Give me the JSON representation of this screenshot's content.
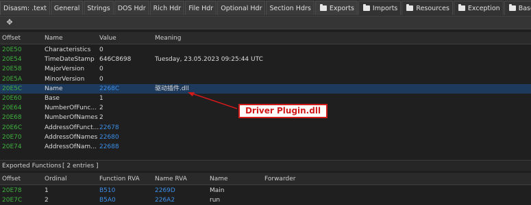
{
  "tabs": [
    {
      "label": "Disasm: .text",
      "folder": false
    },
    {
      "label": "General",
      "folder": false
    },
    {
      "label": "Strings",
      "folder": false
    },
    {
      "label": "DOS Hdr",
      "folder": false
    },
    {
      "label": "Rich Hdr",
      "folder": false
    },
    {
      "label": "File Hdr",
      "folder": false
    },
    {
      "label": "Optional Hdr",
      "folder": false
    },
    {
      "label": "Section Hdrs",
      "folder": false
    },
    {
      "label": "Exports",
      "folder": true
    },
    {
      "label": "Imports",
      "folder": true
    },
    {
      "label": "Resources",
      "folder": true
    },
    {
      "label": "Exception",
      "folder": true
    },
    {
      "label": "BaseReloc",
      "folder": true
    }
  ],
  "toolbar": {
    "icon": "move-icon"
  },
  "export_dir": {
    "columns": [
      "Offset",
      "Name",
      "Value",
      "Meaning"
    ],
    "rows": [
      {
        "offset": "20E50",
        "name": "Characteristics",
        "value": "0",
        "meaning": "",
        "value_link": false
      },
      {
        "offset": "20E54",
        "name": "TimeDateStamp",
        "value": "646C8698",
        "meaning": "Tuesday, 23.05.2023 09:25:44 UTC",
        "value_link": false
      },
      {
        "offset": "20E58",
        "name": "MajorVersion",
        "value": "0",
        "meaning": "",
        "value_link": false
      },
      {
        "offset": "20E5A",
        "name": "MinorVersion",
        "value": "0",
        "meaning": "",
        "value_link": false
      },
      {
        "offset": "20E5C",
        "name": "Name",
        "value": "2268C",
        "meaning": "驱动插件.dll",
        "value_link": true
      },
      {
        "offset": "20E60",
        "name": "Base",
        "value": "1",
        "meaning": "",
        "value_link": false
      },
      {
        "offset": "20E64",
        "name": "NumberOfFunc...",
        "value": "2",
        "meaning": "",
        "value_link": false
      },
      {
        "offset": "20E68",
        "name": "NumberOfNames",
        "value": "2",
        "meaning": "",
        "value_link": false
      },
      {
        "offset": "20E6C",
        "name": "AddressOfFunct...",
        "value": "22678",
        "meaning": "",
        "value_link": true
      },
      {
        "offset": "20E70",
        "name": "AddressOfNames",
        "value": "22680",
        "meaning": "",
        "value_link": true
      },
      {
        "offset": "20E74",
        "name": "AddressOfNam...",
        "value": "22688",
        "meaning": "",
        "value_link": true
      }
    ]
  },
  "annotation": {
    "text": "Driver Plugin.dll"
  },
  "exported_functions": {
    "title": "Exported Functions",
    "count": "[ 2 entries ]",
    "columns": [
      "Offset",
      "Ordinal",
      "Function RVA",
      "Name RVA",
      "Name",
      "Forwarder"
    ],
    "rows": [
      {
        "offset": "20E78",
        "ordinal": "1",
        "function_rva": "B510",
        "name_rva": "2269D",
        "name": "Main",
        "forwarder": ""
      },
      {
        "offset": "20E7C",
        "ordinal": "2",
        "function_rva": "B5A0",
        "name_rva": "226A2",
        "name": "run",
        "forwarder": ""
      }
    ]
  },
  "colors": {
    "offset": "#3fb23f",
    "link": "#3c8fe8",
    "annotation": "#d11a1a"
  }
}
